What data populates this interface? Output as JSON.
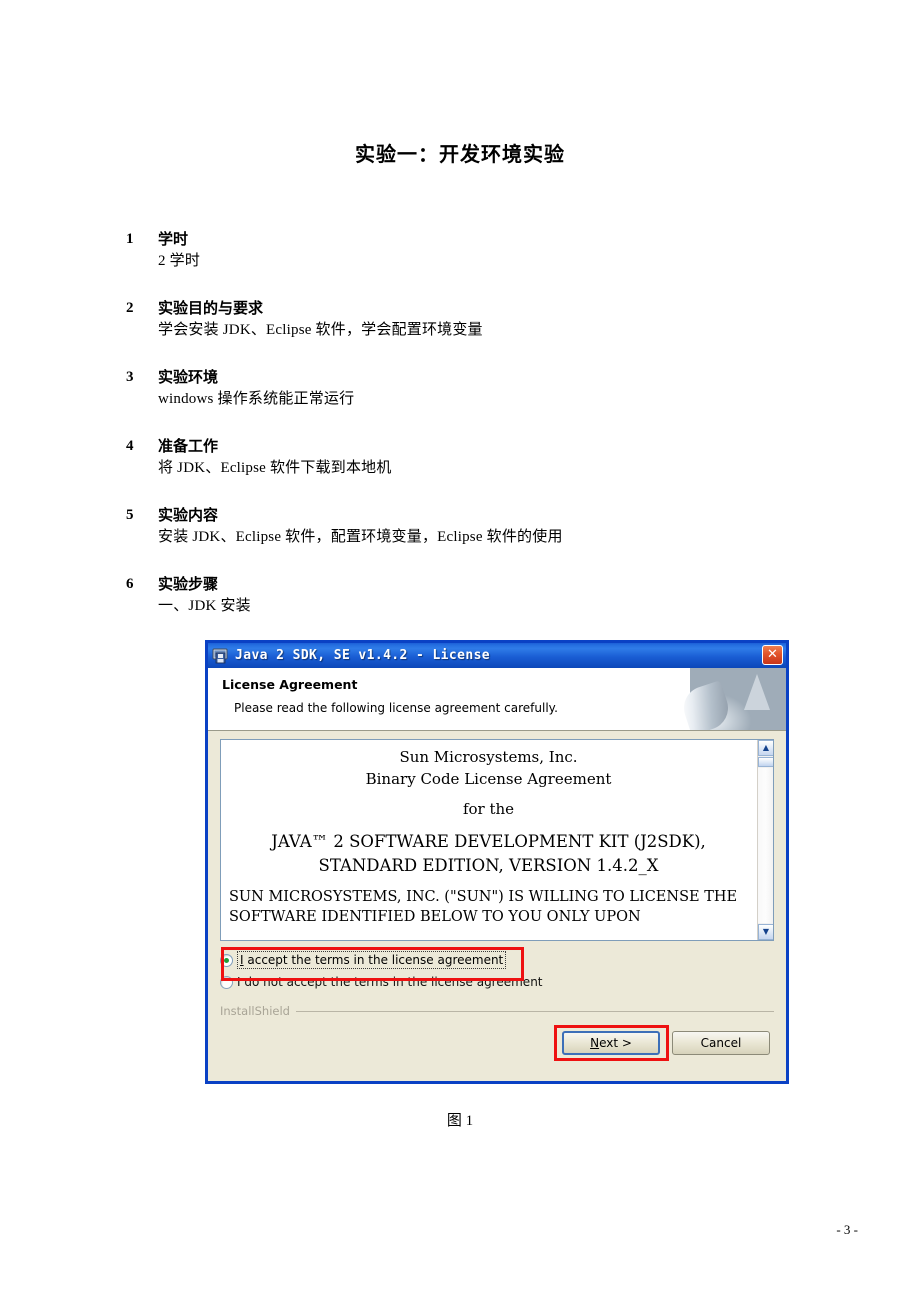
{
  "document": {
    "title": "实验一：开发环境实验",
    "figure_caption": "图 1",
    "page_footer": "- 3 -"
  },
  "sections": [
    {
      "number": "1",
      "heading": "学时",
      "body": "2 学时"
    },
    {
      "number": "2",
      "heading": "实验目的与要求",
      "body": "学会安装 JDK、Eclipse 软件，学会配置环境变量"
    },
    {
      "number": "3",
      "heading": "实验环境",
      "body": "windows 操作系统能正常运行"
    },
    {
      "number": "4",
      "heading": "准备工作",
      "body": "将 JDK、Eclipse 软件下载到本地机"
    },
    {
      "number": "5",
      "heading": "实验内容",
      "body": "安装 JDK、Eclipse 软件，配置环境变量，Eclipse 软件的使用"
    },
    {
      "number": "6",
      "heading": "实验步骤",
      "body": "一、JDK 安装"
    }
  ],
  "dialog": {
    "titlebar": {
      "title": "Java 2 SDK, SE v1.4.2 - License",
      "icon": "installer-package-icon",
      "close_label": "✕"
    },
    "header": {
      "title": "License Agreement",
      "subtitle": "Please read the following license agreement carefully."
    },
    "license": {
      "line1": "Sun Microsystems, Inc.",
      "line2": "Binary Code License Agreement",
      "line3": "for the",
      "line4": "JAVA™ 2 SOFTWARE DEVELOPMENT KIT (J2SDK),",
      "line5": "STANDARD EDITION, VERSION 1.4.2_X",
      "paragraph": "SUN MICROSYSTEMS, INC. (\"SUN\") IS WILLING TO LICENSE THE SOFTWARE IDENTIFIED BELOW TO YOU ONLY UPON"
    },
    "scrollbar": {
      "up_arrow": "▲",
      "down_arrow": "▼"
    },
    "radios": [
      {
        "label_prefix": "I",
        "label_rest": " accept the terms in the license agreement",
        "selected": true
      },
      {
        "label_prefix": "I d",
        "label_rest": "o not accept the terms in the license agreement",
        "selected": false
      }
    ],
    "installshield_label": "InstallShield",
    "buttons": {
      "next_prefix": "N",
      "next_rest": "ext >",
      "cancel": "Cancel"
    },
    "annotation_color": "#ee1111",
    "accent_color": "#0a41c4",
    "face_color": "#ece9d8"
  }
}
